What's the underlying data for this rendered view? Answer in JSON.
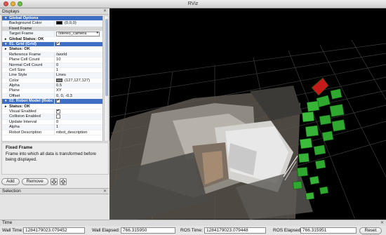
{
  "window": {
    "title": "RViz"
  },
  "displays": {
    "header": "Displays",
    "rows": [
      {
        "kind": "cat",
        "label": "Global Options",
        "expander": "▾"
      },
      {
        "label": "Background Color",
        "value": "(0,0,0)",
        "swatch": "#000000"
      },
      {
        "label": "Fixed Frame",
        "value": "",
        "selected": true
      },
      {
        "label": "Target Frame",
        "value": "/stereo_camera",
        "combo": true
      },
      {
        "kind": "status",
        "label": "Global Status: OK",
        "expander": "▸"
      },
      {
        "kind": "cat",
        "label": "01. Grid (Grid)",
        "expander": "▾",
        "check": true
      },
      {
        "kind": "status",
        "label": "Status: OK",
        "expander": "▸"
      },
      {
        "label": "Reference Frame",
        "value": "/world"
      },
      {
        "label": "Plane Cell Count",
        "value": "10"
      },
      {
        "label": "Normal Cell Count",
        "value": "0"
      },
      {
        "label": "Cell Size",
        "value": "1"
      },
      {
        "label": "Line Style",
        "value": "Lines"
      },
      {
        "label": "Color",
        "value": "(127,127,127)",
        "swatch": "#7f7f7f"
      },
      {
        "label": "Alpha",
        "value": "0.5"
      },
      {
        "label": "Plane",
        "value": "XY"
      },
      {
        "label": "Offset",
        "value": "0, 0, -0.3"
      },
      {
        "kind": "cat",
        "label": "02. Robot Model (Robot M",
        "expander": "▾",
        "check": true
      },
      {
        "kind": "status",
        "label": "Status: OK",
        "expander": "▸"
      },
      {
        "label": "Visual Enabled",
        "check": true
      },
      {
        "label": "Collision Enabled",
        "check": false
      },
      {
        "label": "Update Interval",
        "value": "0"
      },
      {
        "label": "Alpha",
        "value": "1"
      },
      {
        "label": "Robot Description",
        "value": "robot_description"
      }
    ]
  },
  "help": {
    "heading": "Fixed Frame",
    "body": "Frame into which all data is transformed before being displayed."
  },
  "buttons": {
    "add": "Add",
    "remove": "Remove",
    "up_icon": "arrow-up-icon",
    "down_icon": "arrow-down-icon"
  },
  "selection": {
    "header": "Selection"
  },
  "time": {
    "header": "Time",
    "wall_time_label": "Wall Time:",
    "wall_time": "1284179023.079452",
    "wall_elapsed_label": "Wall Elapsed:",
    "wall_elapsed": "766.315950",
    "ros_time_label": "ROS Time:",
    "ros_time": "1284179023.079448",
    "ros_elapsed_label": "ROS Elapsed:",
    "ros_elapsed": "766.315951",
    "reset_label": "Reset"
  },
  "colors": {
    "category_row": "#3f6fc4",
    "viewport_bg": "#000000",
    "robot_green": "#2fa82f",
    "robot_red": "#c41a1a",
    "grid": "#7f7f7f"
  }
}
